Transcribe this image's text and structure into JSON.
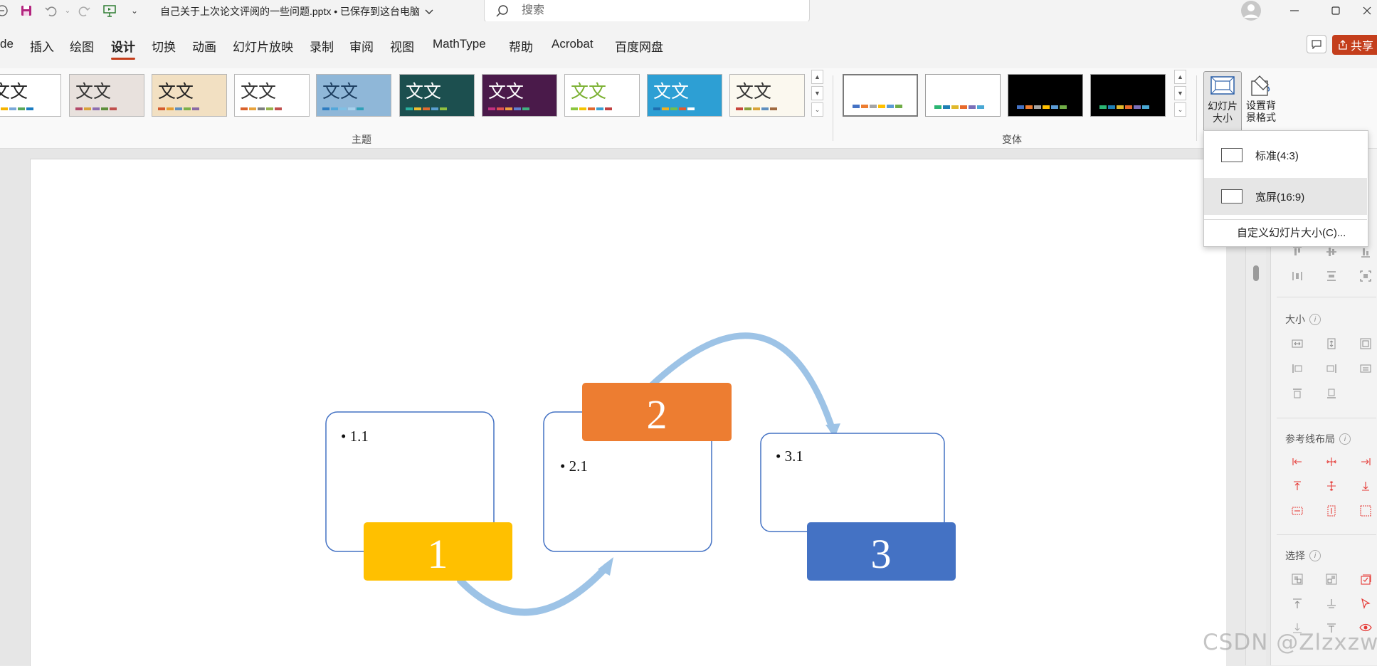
{
  "titlebar": {
    "doc_title": "自己关于上次论文评阅的一些问题.pptx • 已保存到这台电脑",
    "search_placeholder": "搜索"
  },
  "tabs": [
    "de",
    "插入",
    "绘图",
    "设计",
    "切换",
    "动画",
    "幻灯片放映",
    "录制",
    "审阅",
    "视图",
    "MathType",
    "帮助",
    "Acrobat",
    "百度网盘"
  ],
  "active_tab": "设计",
  "share_label": "共享",
  "ribbon": {
    "themes_group_label": "主题",
    "variants_group_label": "变体",
    "themes": [
      {
        "text": "文文",
        "bg": "#ffffff",
        "fg": "#222222",
        "swatches": [
          "#e26b2a",
          "#f5b300",
          "#7aa8d8",
          "#5aa85a",
          "#1a7cc1"
        ]
      },
      {
        "text": "文文",
        "bg": "#e8e1dd",
        "fg": "#333333",
        "swatches": [
          "#b34a6a",
          "#d9a23b",
          "#8e6fb0",
          "#5e8f3c",
          "#c0504d"
        ]
      },
      {
        "text": "文文",
        "bg": "#f2e0c2",
        "fg": "#222222",
        "swatches": [
          "#d45b2e",
          "#e49e32",
          "#5f8fbf",
          "#7cb04a",
          "#8a6aa5"
        ]
      },
      {
        "text": "文文",
        "bg": "#ffffff",
        "fg": "#333333",
        "swatches": [
          "#d9622b",
          "#e8a33c",
          "#7f7f7f",
          "#96b34b",
          "#c0504d"
        ]
      },
      {
        "text": "文文",
        "bg": "#8fb7d8",
        "fg": "#1b3c5e",
        "swatches": [
          "#2e7cc1",
          "#53a7da",
          "#80c0e4",
          "#a6d0ec",
          "#30a0b8"
        ]
      },
      {
        "text": "文文",
        "bg": "#1c4f4f",
        "fg": "#ffffff",
        "swatches": [
          "#2ab0a0",
          "#f0c030",
          "#e06a30",
          "#5a9fd0",
          "#90c040"
        ]
      },
      {
        "text": "文文",
        "bg": "#4a1a4a",
        "fg": "#ffffff",
        "swatches": [
          "#c03080",
          "#e05050",
          "#f0a040",
          "#6080d0",
          "#40b080"
        ]
      },
      {
        "text": "文文",
        "bg": "#ffffff",
        "fg": "#7ab030",
        "swatches": [
          "#8cc63f",
          "#f5c400",
          "#e06a30",
          "#3aa0d0",
          "#c04040"
        ]
      },
      {
        "text": "文文",
        "bg": "#2d9fd4",
        "fg": "#ffffff",
        "swatches": [
          "#1f6fb0",
          "#f0b020",
          "#70c050",
          "#e05a30",
          "#ffffff"
        ]
      },
      {
        "text": "文文",
        "bg": "#fbf8ef",
        "fg": "#333333",
        "swatches": [
          "#c8463c",
          "#8a9f3a",
          "#d9a33a",
          "#5f8fbf",
          "#a06a40"
        ]
      }
    ],
    "variants": [
      {
        "bg": "#ffffff",
        "swatches": [
          "#4472c4",
          "#ed7d31",
          "#a5a5a5",
          "#ffc000",
          "#5b9bd5",
          "#70ad47"
        ]
      },
      {
        "bg": "#ffffff",
        "swatches": [
          "#2bb573",
          "#1f7fb4",
          "#e0b92c",
          "#e86a2b",
          "#7a6fb8",
          "#49a8d4"
        ]
      },
      {
        "bg": "#000000",
        "swatches": [
          "#4472c4",
          "#ed7d31",
          "#a5a5a5",
          "#ffc000",
          "#5b9bd5",
          "#70ad47"
        ]
      },
      {
        "bg": "#000000",
        "swatches": [
          "#2bb573",
          "#1f7fb4",
          "#e0b92c",
          "#e86a2b",
          "#7a6fb8",
          "#49a8d4"
        ]
      }
    ],
    "slide_size_btn": "幻灯片\n大小",
    "format_bg_btn": "设置背\n景格式"
  },
  "dropdown": {
    "items": [
      "标准(4:3)",
      "宽屏(16:9)"
    ],
    "custom": "自定义幻灯片大小(C)...",
    "highlighted_index": 1
  },
  "slide": {
    "boxes": [
      {
        "bullet": "• 1.1",
        "number": "1",
        "color": "#ffc000"
      },
      {
        "bullet": "• 2.1",
        "number": "2",
        "color": "#ed7d31"
      },
      {
        "bullet": "• 3.1",
        "number": "3",
        "color": "#4472c4"
      }
    ],
    "arrow_color": "#9dc3e6",
    "outline_color": "#4472c4"
  },
  "pane": {
    "size_title": "大小",
    "guides_title": "参考线布局",
    "select_title": "选择"
  },
  "watermark": "CSDN @Zlzxzw"
}
